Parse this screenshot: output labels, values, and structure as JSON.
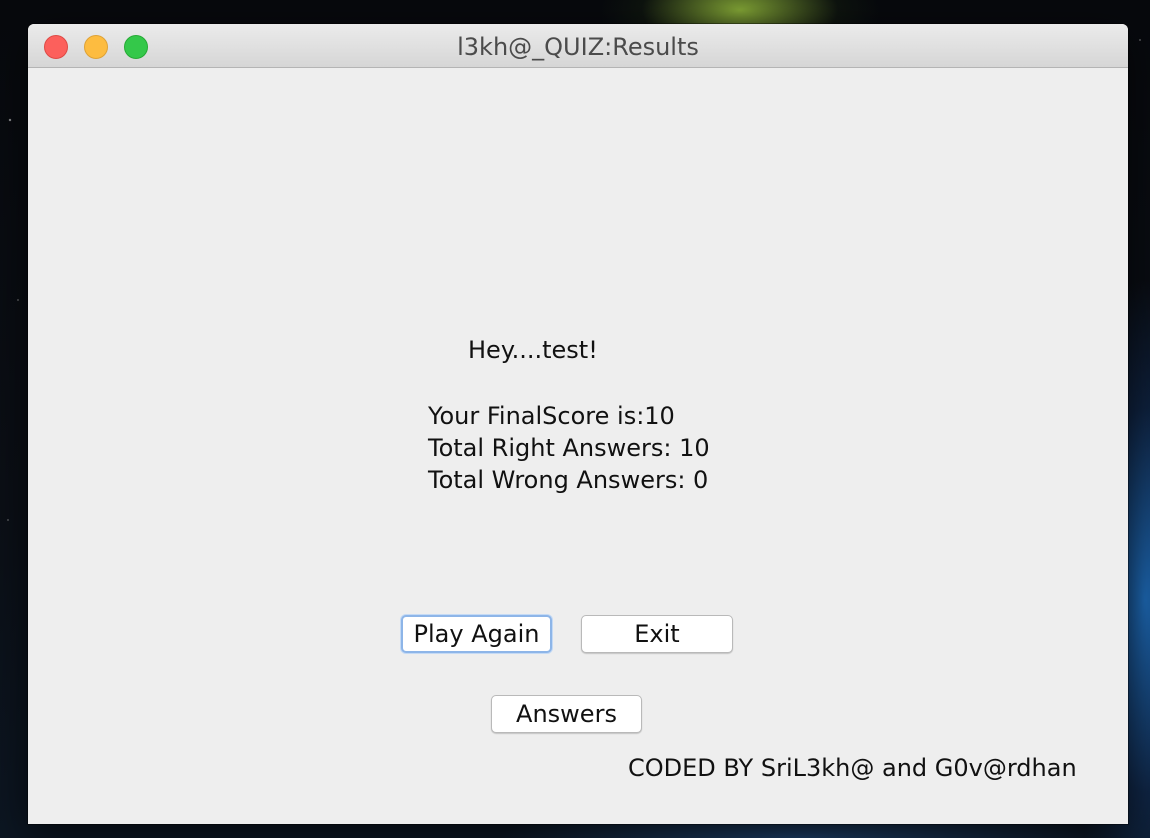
{
  "window": {
    "title": "l3kh@_QUIZ:Results"
  },
  "results": {
    "greeting": "Hey....test!",
    "final_score": "Your FinalScore is:10",
    "right_answers": "Total Right Answers: 10",
    "wrong_answers": "Total Wrong Answers: 0"
  },
  "buttons": {
    "play_again": "Play Again",
    "exit": "Exit",
    "answers": "Answers"
  },
  "footer": {
    "credits": "CODED BY  SriL3kh@ and G0v@rdhan"
  },
  "colors": {
    "close": "#fc605c",
    "minimize": "#fdbc40",
    "zoom": "#34c84a",
    "focus_ring": "#8db5e8",
    "window_bg": "#eeeeee"
  }
}
